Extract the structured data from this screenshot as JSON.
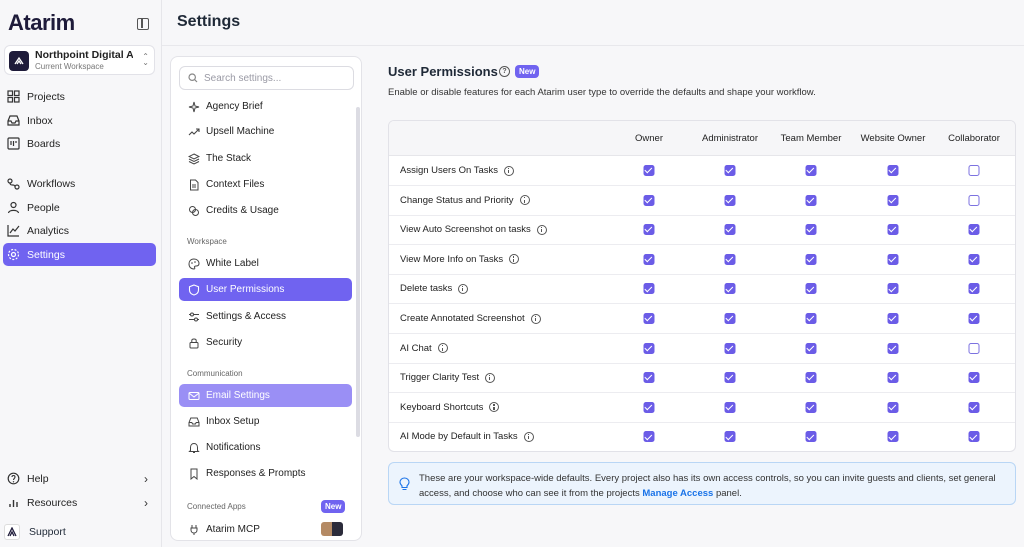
{
  "app": {
    "logo": "Atarim",
    "page_title": "Settings"
  },
  "workspace": {
    "name": "Northpoint Digital Ag...",
    "subtitle": "Current Workspace"
  },
  "nav": {
    "primary": [
      {
        "label": "Projects",
        "icon": "grid-icon"
      },
      {
        "label": "Inbox",
        "icon": "inbox-icon"
      },
      {
        "label": "Boards",
        "icon": "board-icon"
      }
    ],
    "secondary": [
      {
        "label": "Workflows",
        "icon": "workflow-icon"
      },
      {
        "label": "People",
        "icon": "person-icon"
      },
      {
        "label": "Analytics",
        "icon": "chart-icon"
      },
      {
        "label": "Settings",
        "icon": "gear-icon",
        "active": true
      }
    ],
    "bottom": [
      {
        "label": "Help",
        "icon": "help-icon"
      },
      {
        "label": "Resources",
        "icon": "bars-icon"
      }
    ],
    "support": "Support"
  },
  "settings_panel": {
    "search_placeholder": "Search settings...",
    "items_top": [
      "Agency Brief",
      "Upsell Machine",
      "The Stack",
      "Context Files",
      "Credits & Usage"
    ],
    "section_workspace": "Workspace",
    "items_workspace": [
      "White Label",
      "User Permissions",
      "Settings & Access",
      "Security"
    ],
    "section_communication": "Communication",
    "items_communication": [
      "Email Settings",
      "Inbox Setup",
      "Notifications",
      "Responses & Prompts"
    ],
    "section_connected": "Connected Apps",
    "connected_badge": "New",
    "items_connected": [
      "Atarim MCP"
    ]
  },
  "main": {
    "title": "User Permissions",
    "badge": "New",
    "description": "Enable or disable features for each Atarim user type to override the defaults and shape your workflow.",
    "columns": [
      "Owner",
      "Administrator",
      "Team Member",
      "Website Owner",
      "Collaborator"
    ],
    "rows": [
      {
        "label": "Assign Users On Tasks",
        "values": [
          true,
          true,
          true,
          true,
          false
        ]
      },
      {
        "label": "Change Status and Priority",
        "values": [
          true,
          true,
          true,
          true,
          false
        ]
      },
      {
        "label": "View Auto Screenshot on tasks",
        "values": [
          true,
          true,
          true,
          true,
          true
        ]
      },
      {
        "label": "View More Info on Tasks",
        "values": [
          true,
          true,
          true,
          true,
          true
        ]
      },
      {
        "label": "Delete tasks",
        "values": [
          true,
          true,
          true,
          true,
          true
        ]
      },
      {
        "label": "Create Annotated Screenshot",
        "values": [
          true,
          true,
          true,
          true,
          true
        ]
      },
      {
        "label": "AI Chat",
        "values": [
          true,
          true,
          true,
          true,
          false
        ]
      },
      {
        "label": "Trigger Clarity Test",
        "values": [
          true,
          true,
          true,
          true,
          true
        ]
      },
      {
        "label": "Keyboard Shortcuts",
        "values": [
          true,
          true,
          true,
          true,
          true
        ]
      },
      {
        "label": "AI Mode by Default in Tasks",
        "values": [
          true,
          true,
          true,
          true,
          true
        ]
      }
    ],
    "note_text": "These are your workspace-wide defaults. Every project also has its own access controls, so you can invite guests and clients, set general access, and choose who can see it from the projects ",
    "note_link": "Manage Access",
    "note_suffix": " panel."
  },
  "colors": {
    "accent": "#7063f0",
    "checkbox": "#6b5ce7",
    "note_bg": "#ecf4fd",
    "link": "#1a73e8"
  }
}
